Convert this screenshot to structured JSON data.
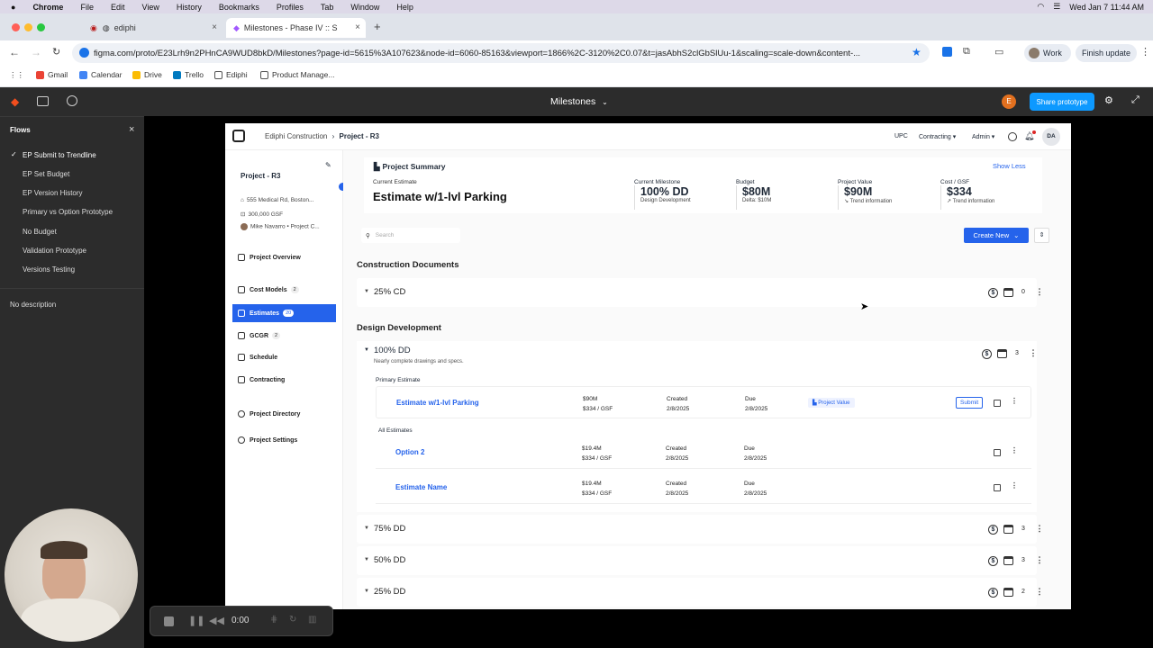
{
  "menubar": {
    "app": "Chrome",
    "items": [
      "File",
      "Edit",
      "View",
      "History",
      "Bookmarks",
      "Profiles",
      "Tab",
      "Window",
      "Help"
    ],
    "clock": "Wed Jan 7  11:44 AM"
  },
  "browser": {
    "tabs": [
      {
        "title": "ediphi"
      },
      {
        "title": "Milestones - Phase IV :: S"
      }
    ],
    "url": "figma.com/proto/E23Lrh9n2PHnCA9WUD8bkD/Milestones?page-id=5615%3A107623&node-id=6060-85163&viewport=1866%2C-3120%2C0.07&t=jasAbhS2clGbSlUu-1&scaling=scale-down&content-...",
    "profile": "Work",
    "finish_update": "Finish update",
    "gemini": "Gemini",
    "bookmarks": [
      "Gmail",
      "Calendar",
      "Drive",
      "Trello",
      "Ediphi",
      "Product Manage..."
    ]
  },
  "figma": {
    "title": "Milestones",
    "share": "Share prototype",
    "avatar": "E",
    "flows_title": "Flows",
    "flows": [
      "EP Submit to Trendline",
      "EP Set Budget",
      "EP Version History",
      "Primary vs Option Prototype",
      "No Budget",
      "Validation Prototype",
      "Versions Testing"
    ],
    "active_flow": "EP Submit to Trendline",
    "description": "No description"
  },
  "app": {
    "breadcrumb": {
      "org": "Ediphi Construction",
      "project": "Project - R3"
    },
    "topnav": {
      "upc": "UPC",
      "contracting": "Contracting",
      "admin": "Admin",
      "avatar": "DA"
    },
    "project": {
      "name": "Project - R3",
      "address": "555 Medical Rd, Boston...",
      "area": "300,000 GSF",
      "people": "Mike Navarro • Project C..."
    },
    "nav": [
      {
        "label": "Project Overview",
        "badge": ""
      },
      {
        "label": "Cost Models",
        "badge": "2"
      },
      {
        "label": "Estimates",
        "badge": "20"
      },
      {
        "label": "GCGR",
        "badge": "2"
      },
      {
        "label": "Schedule",
        "badge": ""
      },
      {
        "label": "Contracting",
        "badge": ""
      },
      {
        "label": "Project Directory",
        "badge": ""
      },
      {
        "label": "Project Settings",
        "badge": ""
      }
    ],
    "summary": {
      "title": "Project Summary",
      "show_less": "Show Less",
      "current_estimate_label": "Current Estimate",
      "current_estimate": "Estimate w/1-lvl Parking",
      "metrics": [
        {
          "label": "Current Milestone",
          "value": "100% DD",
          "sub": "Design Development"
        },
        {
          "label": "Budget",
          "value": "$80M",
          "sub": "Delta: $10M"
        },
        {
          "label": "Project Value",
          "value": "$90M",
          "sub": "Trend information"
        },
        {
          "label": "Cost / GSF",
          "value": "$334",
          "sub": "Trend information"
        }
      ]
    },
    "search_placeholder": "Search",
    "create_new": "Create New",
    "sections": {
      "cd": "Construction Documents",
      "dd": "Design Development"
    },
    "cd_groups": [
      {
        "label": "25% CD",
        "count": "0"
      }
    ],
    "dd_open": {
      "label": "100% DD",
      "desc": "Nearly complete drawings and specs.",
      "count": "3",
      "primary_label": "Primary Estimate",
      "all_label": "All Estimates",
      "primary": {
        "name": "Estimate w/1-lvl Parking",
        "value": "$90M",
        "gsf": "$334 / GSF",
        "created_label": "Created",
        "created": "2/8/2025",
        "due_label": "Due",
        "due": "2/8/2025",
        "tag": "Project Value",
        "submit": "Submit"
      },
      "others": [
        {
          "name": "Option 2",
          "value": "$19.4M",
          "gsf": "$334 / GSF",
          "created_label": "Created",
          "created": "2/8/2025",
          "due_label": "Due",
          "due": "2/8/2025"
        },
        {
          "name": "Estimate Name",
          "value": "$19.4M",
          "gsf": "$334 / GSF",
          "created_label": "Created",
          "created": "2/8/2025",
          "due_label": "Due",
          "due": "2/8/2025"
        }
      ]
    },
    "dd_groups": [
      {
        "label": "75% DD",
        "count": "3"
      },
      {
        "label": "50% DD",
        "count": "3"
      },
      {
        "label": "25% DD",
        "count": "2"
      }
    ]
  },
  "recorder": {
    "time": "0:00"
  },
  "colors": {
    "accent": "#2563eb",
    "figma_bar": "#2c2c2c"
  }
}
